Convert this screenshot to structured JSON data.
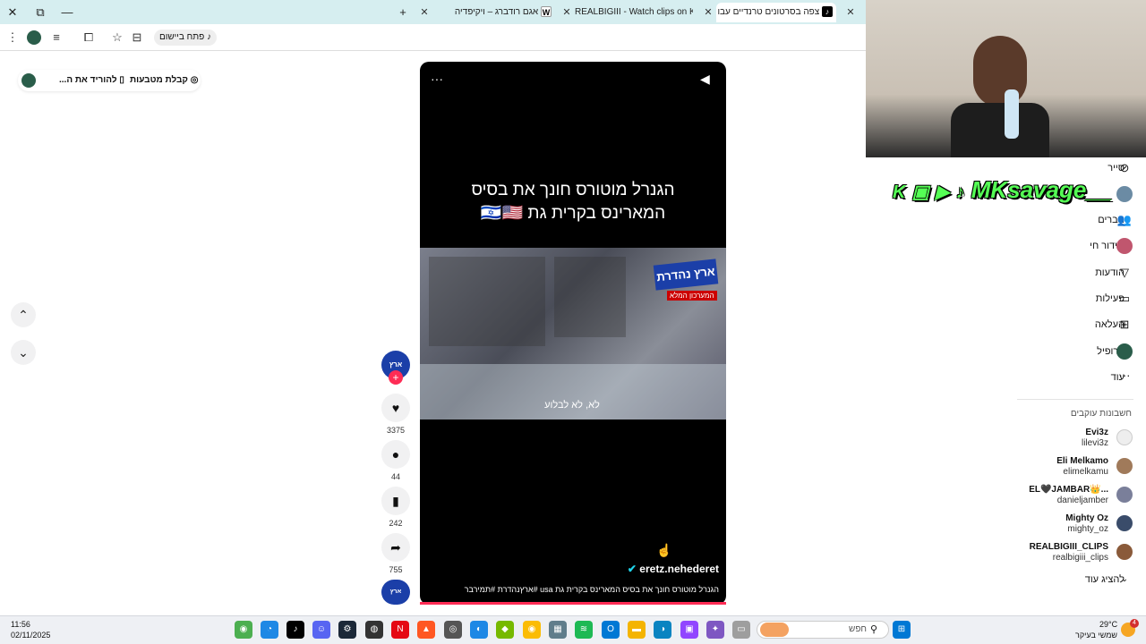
{
  "browser": {
    "tabs": [
      {
        "title": "צפה בסרטונים טרנדיים עבו",
        "icon": "tiktok-icon",
        "active": true
      },
      {
        "title": "REALBIGIII - Watch clips on Kick",
        "icon": "kick-icon",
        "active": false
      },
      {
        "title": "אגם רודברג – ויקיפדיה",
        "icon": "wikipedia-icon",
        "active": false
      }
    ],
    "open_in_app_label": "פתח ביישום"
  },
  "top_banner": {
    "get_coins": "קבלת מטבעות",
    "download_app": "להוריד את ה..."
  },
  "video": {
    "title_line1": "הגנרל מוטורס חונך את בסיס",
    "title_line2": "המארינס בקרית גת 🇮🇱🇺🇸",
    "subtitle_text": "לא, לא לבלוע",
    "watermark": "ארץ נהדרת",
    "watermark_sub": "המערכון המלא",
    "author": "eretz.nehederet",
    "caption": "הגנרל מוטורס חונך את בסיס המארינס בקרית גת usa #ארץנהדרת #תמירבר"
  },
  "actions": {
    "likes": "3375",
    "comments": "44",
    "saves": "242",
    "shares": "755"
  },
  "stream_overlay": {
    "channel": "MKsavage__"
  },
  "sidebar": {
    "items": [
      {
        "label": "סייר",
        "icon": "compass-icon"
      },
      {
        "label": "חברים",
        "icon": "friends-icon"
      },
      {
        "label": "שידור חי",
        "icon": "live-icon"
      },
      {
        "label": "הודעות",
        "icon": "send-icon"
      },
      {
        "label": "פעילות",
        "icon": "activity-icon"
      },
      {
        "label": "העלאה",
        "icon": "upload-icon"
      },
      {
        "label": "פרופיל",
        "icon": "profile-icon"
      },
      {
        "label": "עוד",
        "icon": "more-icon"
      }
    ],
    "following_header": "חשבונות עוקבים",
    "following": [
      {
        "name": "Evi3z",
        "handle": "lilevi3z"
      },
      {
        "name": "Eli Melkamo",
        "handle": "elimelkamu"
      },
      {
        "name": "EL🖤JAMBAR👑...",
        "handle": "danieljamber"
      },
      {
        "name": "Mighty Oz",
        "handle": "mighty_oz"
      },
      {
        "name": "REALBIGIII_CLIPS",
        "handle": "realbigiii_clips"
      }
    ],
    "show_more": "להציג עוד"
  },
  "taskbar": {
    "time": "11:56",
    "date": "02/11/2025",
    "search_placeholder": "חפש",
    "weather_temp": "29°C",
    "weather_desc": "שמשי בעיקר",
    "notification_count": "4"
  }
}
